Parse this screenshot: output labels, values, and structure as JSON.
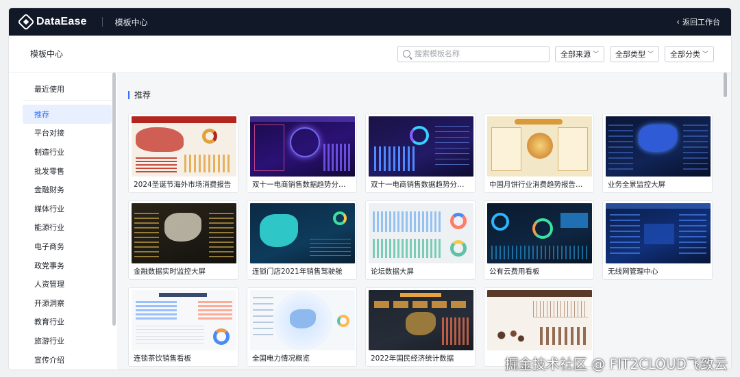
{
  "topbar": {
    "brand": "DataEase",
    "title": "模板中心",
    "back_label": "返回工作台"
  },
  "subhead": {
    "breadcrumb": "模板中心",
    "search_placeholder": "搜索模板名称",
    "filters": [
      "全部来源",
      "全部类型",
      "全部分类"
    ]
  },
  "sidebar": {
    "items": [
      "最近使用",
      "推荐",
      "平台对接",
      "制造行业",
      "批发零售",
      "金融财务",
      "媒体行业",
      "能源行业",
      "电子商务",
      "政党事务",
      "人资管理",
      "开源洞察",
      "教育行业",
      "旅游行业",
      "宣传介绍"
    ],
    "active_index": 1
  },
  "section": {
    "title": "推荐"
  },
  "cards": [
    {
      "label": "2024圣诞节海外市场消费报告",
      "thumb": "red"
    },
    {
      "label": "双十一电商销售数据趋势分析-2...",
      "thumb": "purple"
    },
    {
      "label": "双十一电商销售数据趋势分析-...",
      "thumb": "blue"
    },
    {
      "label": "中国月饼行业消费趋势报告（...",
      "thumb": "cream"
    },
    {
      "label": "业务全景监控大屏",
      "thumb": "navy"
    },
    {
      "label": "金融数据实时监控大屏",
      "thumb": "dark"
    },
    {
      "label": "连锁门店2021年销售驾驶舱",
      "thumb": "teal"
    },
    {
      "label": "论坛数据大屏",
      "thumb": "light"
    },
    {
      "label": "公有云费用看板",
      "thumb": "cloud"
    },
    {
      "label": "无线网管理中心",
      "thumb": "net"
    },
    {
      "label": "连锁茶饮销售看板",
      "thumb": "white"
    },
    {
      "label": "全国电力情况概览",
      "thumb": "power"
    },
    {
      "label": "2022年国民经济统计数据",
      "thumb": "econ"
    },
    {
      "label": "",
      "thumb": "coffee"
    }
  ],
  "watermark": "掘金技术社区 @ FIT2CLOUD飞致云",
  "icons": {
    "logo": "dataease-logo-icon",
    "back": "chevron-left-icon",
    "search": "search-icon",
    "dropdown": "chevron-down-icon"
  }
}
